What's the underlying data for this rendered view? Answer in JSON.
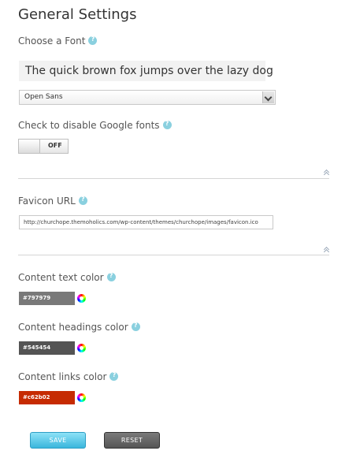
{
  "page": {
    "title": "General Settings"
  },
  "font": {
    "label": "Choose a Font",
    "preview": "The quick brown fox jumps over the lazy dog",
    "selected": "Open Sans"
  },
  "google_fonts": {
    "label": "Check to disable Google fonts",
    "toggle_state": "OFF"
  },
  "favicon": {
    "label": "Favicon URL",
    "value": "http://churchope.themoholics.com/wp-content/themes/churchope/images/favicon.ico"
  },
  "colors": {
    "content_text": {
      "label": "Content text color",
      "value": "#797979"
    },
    "content_headings": {
      "label": "Content headings color",
      "value": "#545454"
    },
    "content_links": {
      "label": "Content links color",
      "value": "#c62b02"
    }
  },
  "actions": {
    "save": "SAVE",
    "reset": "RESET"
  },
  "icons": {
    "help": "help-icon",
    "dropdown": "chevron-down-icon",
    "collapse": "double-chevron-up-icon",
    "color_picker": "color-wheel-icon"
  }
}
